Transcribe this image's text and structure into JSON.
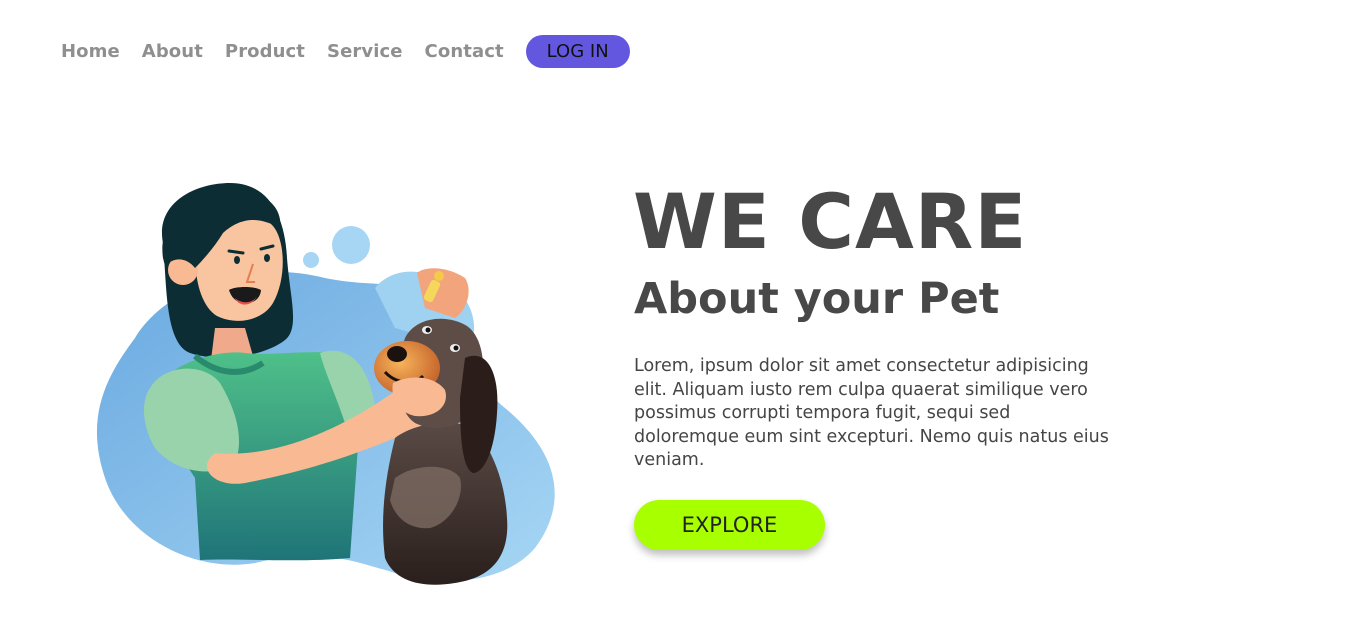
{
  "nav": {
    "links": [
      "Home",
      "About",
      "Product",
      "Service",
      "Contact"
    ],
    "login_label": "LOG IN"
  },
  "hero": {
    "headline": "WE CARE",
    "subheadline": "About your Pet",
    "description": "Lorem, ipsum dolor sit amet consectetur adipisicing elit. Aliquam iusto rem culpa quaerat similique vero possimus corrupti tempora fugit, sequi sed doloremque eum sint excepturi. Nemo quis natus eius veniam.",
    "cta_label": "EXPLORE"
  },
  "colors": {
    "accent_purple": "#6357e0",
    "accent_lime": "#a8ff00",
    "text_dark": "#484848",
    "nav_gray": "#8f8f8f"
  }
}
